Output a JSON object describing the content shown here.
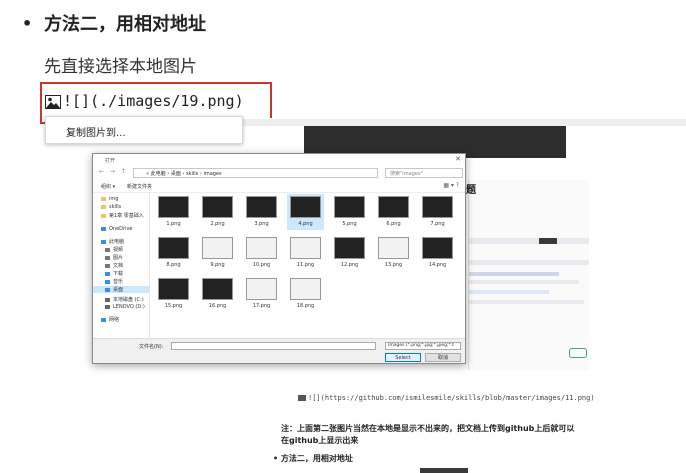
{
  "section": {
    "bullet": "•",
    "heading": "方法二，用相对地址",
    "paragraph": "先直接选择本地图片",
    "code": "![](./images/19.png)"
  },
  "context_menu": {
    "item": "复制图片到..."
  },
  "dialog": {
    "title": "打开",
    "nav_arrows": "← → ↑",
    "path": "« 此电脑 › 桌面 › skills › images",
    "search_placeholder": "搜索\"images\"",
    "organize": "组织 ▾",
    "new_folder": "新建文件夹",
    "sidebar": [
      "img",
      "skills",
      "第1章 零基础入",
      "OneDrive",
      "此电脑",
      "视频",
      "图片",
      "文档",
      "下载",
      "音乐",
      "桌面",
      "本地磁盘 (C:)",
      "LENOVO (D:)",
      "网络"
    ],
    "files": [
      "1.png",
      "2.png",
      "3.png",
      "4.png",
      "5.png",
      "6.png",
      "7.png",
      "8.png",
      "9.png",
      "10.png",
      "11.png",
      "12.png",
      "13.png",
      "14.png",
      "15.png",
      "16.png",
      "17.png",
      "18.png"
    ],
    "filename_label": "文件名(N):",
    "filetype": "Images (*.png;*.jpg;*.jpeg;*.t",
    "select_button": "Select",
    "cancel_button": "取消",
    "close_glyph": "✕"
  },
  "background_doc": {
    "link": "![](https://github.com/ismilesmile/skills/blob/master/images/11.png)",
    "note": "注：上面第二张图片当然在本地是显示不出来的，把文档上传到github上后就可以在github上显示出来",
    "bullet_item": "• 方法二，用相对地址",
    "partial_heading": "题"
  },
  "colors": {
    "highlight_border": "#c3392b",
    "selection": "#cce8ff"
  }
}
